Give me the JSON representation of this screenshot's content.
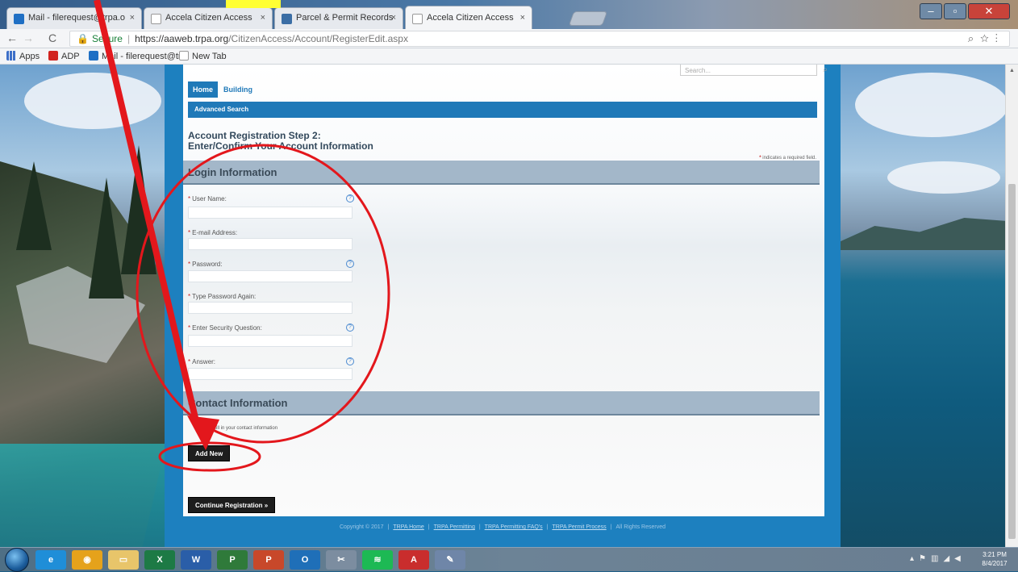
{
  "browser": {
    "tabs": [
      {
        "label": "Mail - filerequest@trpa.o",
        "icon_color": "#1f6fc4"
      },
      {
        "label": "Accela Citizen Access",
        "icon_color": "#ffffff"
      },
      {
        "label": "Parcel & Permit Records",
        "icon_color": "#3b6ea5"
      },
      {
        "label": "Accela Citizen Access",
        "icon_color": "#ffffff",
        "active": true
      }
    ],
    "tab_close": "×",
    "url": {
      "secure_label": "Secure",
      "host": "https://aaweb.trpa.org",
      "path": "/CitizenAccess/Account/RegisterEdit.aspx"
    },
    "bookmarks": [
      {
        "label": "Apps",
        "icon": "apps-grid-icon"
      },
      {
        "label": "ADP",
        "icon": "adp-icon"
      },
      {
        "label": "Mail - filerequest@tr",
        "icon": "outlook-icon"
      },
      {
        "label": "New Tab",
        "icon": "page-icon"
      }
    ]
  },
  "site": {
    "search_placeholder": "Search...",
    "nav_tabs": [
      "Home",
      "Building"
    ],
    "subnav": "Advanced Search",
    "step_title_line1": "Account Registration Step 2:",
    "step_title_line2": "Enter/Confirm Your Account Information",
    "required_note": "indicates a required field.",
    "login_section": "Login Information",
    "fields": [
      {
        "label": "User Name:",
        "help": true
      },
      {
        "label": "E-mail Address:",
        "help": false
      },
      {
        "label": "Password:",
        "help": true
      },
      {
        "label": "Type Password Again:",
        "help": false
      },
      {
        "label": "Enter Security Question:",
        "help": true
      },
      {
        "label": "Answer:",
        "help": true
      }
    ],
    "contact_section": "Contact Information",
    "contact_hint": "how to fill in your contact information",
    "add_new_label": "Add New",
    "continue_label": "Continue Registration »",
    "footer": {
      "copyright": "Copyright © 2017",
      "links": [
        "TRPA Home",
        "TRPA Permitting",
        "TRPA Permitting FAQ's",
        "TRPA Permit Process"
      ],
      "rights": "All Rights Reserved"
    }
  },
  "taskbar": {
    "apps": [
      {
        "name": "ie-icon",
        "glyph": "e",
        "color": "#1f8ed8"
      },
      {
        "name": "chrome-icon",
        "glyph": "◉",
        "color": "#e5a21b"
      },
      {
        "name": "explorer-icon",
        "glyph": "▭",
        "color": "#e8c56a"
      },
      {
        "name": "excel-icon",
        "glyph": "X",
        "color": "#1d7a45"
      },
      {
        "name": "word-icon",
        "glyph": "W",
        "color": "#2a5ea8"
      },
      {
        "name": "project-icon",
        "glyph": "P",
        "color": "#2f7a3a"
      },
      {
        "name": "powerpoint-icon",
        "glyph": "P",
        "color": "#c8482a"
      },
      {
        "name": "outlook-icon",
        "glyph": "O",
        "color": "#1f6fb8"
      },
      {
        "name": "snipping-icon",
        "glyph": "✂",
        "color": "#7c8da0"
      },
      {
        "name": "spotify-icon",
        "glyph": "≋",
        "color": "#1db954"
      },
      {
        "name": "acrobat-icon",
        "glyph": "A",
        "color": "#c92d2d"
      },
      {
        "name": "paint-icon",
        "glyph": "✎",
        "color": "#6f86a8"
      }
    ],
    "time": "3:21 PM",
    "date": "8/4/2017"
  },
  "annotation_color": "#e3171c"
}
